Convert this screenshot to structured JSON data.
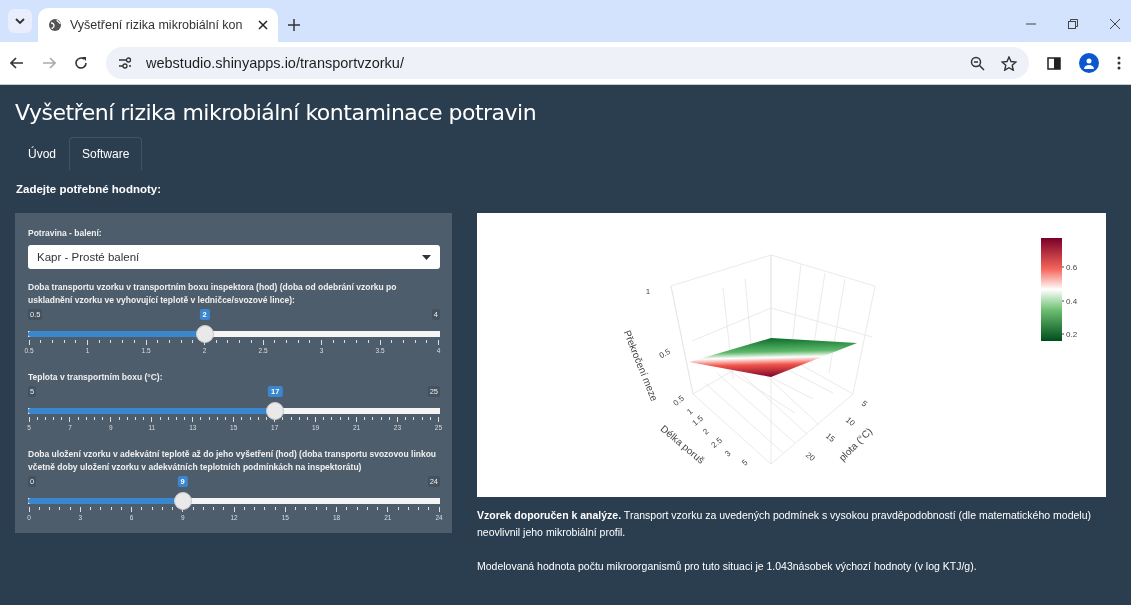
{
  "browser": {
    "tab_title": "Vyšetření rizika mikrobiální kon",
    "url": "webstudio.shinyapps.io/transportvzorku/"
  },
  "page_title": "Vyšetření rizika mikrobiální kontaminace potravin",
  "tabs": [
    {
      "label": "Úvod",
      "selected": false
    },
    {
      "label": "Software",
      "selected": true
    }
  ],
  "section_label": "Zadejte potřebné hodnoty:",
  "inputs": {
    "select": {
      "label": "Potravina - balení:",
      "value": "Kapr - Prosté balení"
    },
    "sliders": [
      {
        "label": "Doba transportu vzorku v transportním boxu inspektora (hod) (doba od odebrání vzorku po uskladnění vzorku ve vyhovující teplotě v ledničce/svozové lince):",
        "min": "0.5",
        "max": "4",
        "value": "2",
        "level": 0.4286,
        "ticks": [
          "0.5",
          "1",
          "1.5",
          "2",
          "2.5",
          "3",
          "3.5",
          "4"
        ]
      },
      {
        "label": "Teplota v transportním boxu (°C):",
        "min": "5",
        "max": "25",
        "value": "17",
        "level": 0.6,
        "ticks": [
          "5",
          "7",
          "9",
          "11",
          "13",
          "15",
          "17",
          "19",
          "21",
          "23",
          "25"
        ]
      },
      {
        "label": "Doba uložení vzorku v adekvátní teplotě až do jeho vyšetření (hod) (doba transportu svozovou linkou včetně doby uložení vzorku v adekvátních teplotních podmínkách na inspektorátu)",
        "min": "0",
        "max": "24",
        "value": "9",
        "level": 0.375,
        "ticks": [
          "0",
          "3",
          "6",
          "9",
          "12",
          "15",
          "18",
          "21",
          "24"
        ]
      }
    ]
  },
  "plot": {
    "z_title": "Překročení meze",
    "x_title": "Délka poruš",
    "y_title": "plota (°C)",
    "z_ticks": [
      "1",
      "0.5"
    ],
    "x_ticks": [
      "0.5",
      "1",
      "1.5",
      "2",
      "2.5",
      "3",
      "5"
    ],
    "y_ticks": [
      "5",
      "10",
      "15",
      "20"
    ],
    "colorbar_ticks": [
      "0.6",
      "0.4",
      "0.2"
    ]
  },
  "result": [
    "**Vzorek doporučen k analýze.** Transport vzorku za uvedených podmínek s vysokou pravděpodobností (dle matematického modelu) neovlivnil jeho mikrobiální profil.",
    "Modelovaná hodnota počtu mikroorganismů pro tuto situaci je 1.043násobek výchozí hodnoty (v log KTJ/g)."
  ]
}
